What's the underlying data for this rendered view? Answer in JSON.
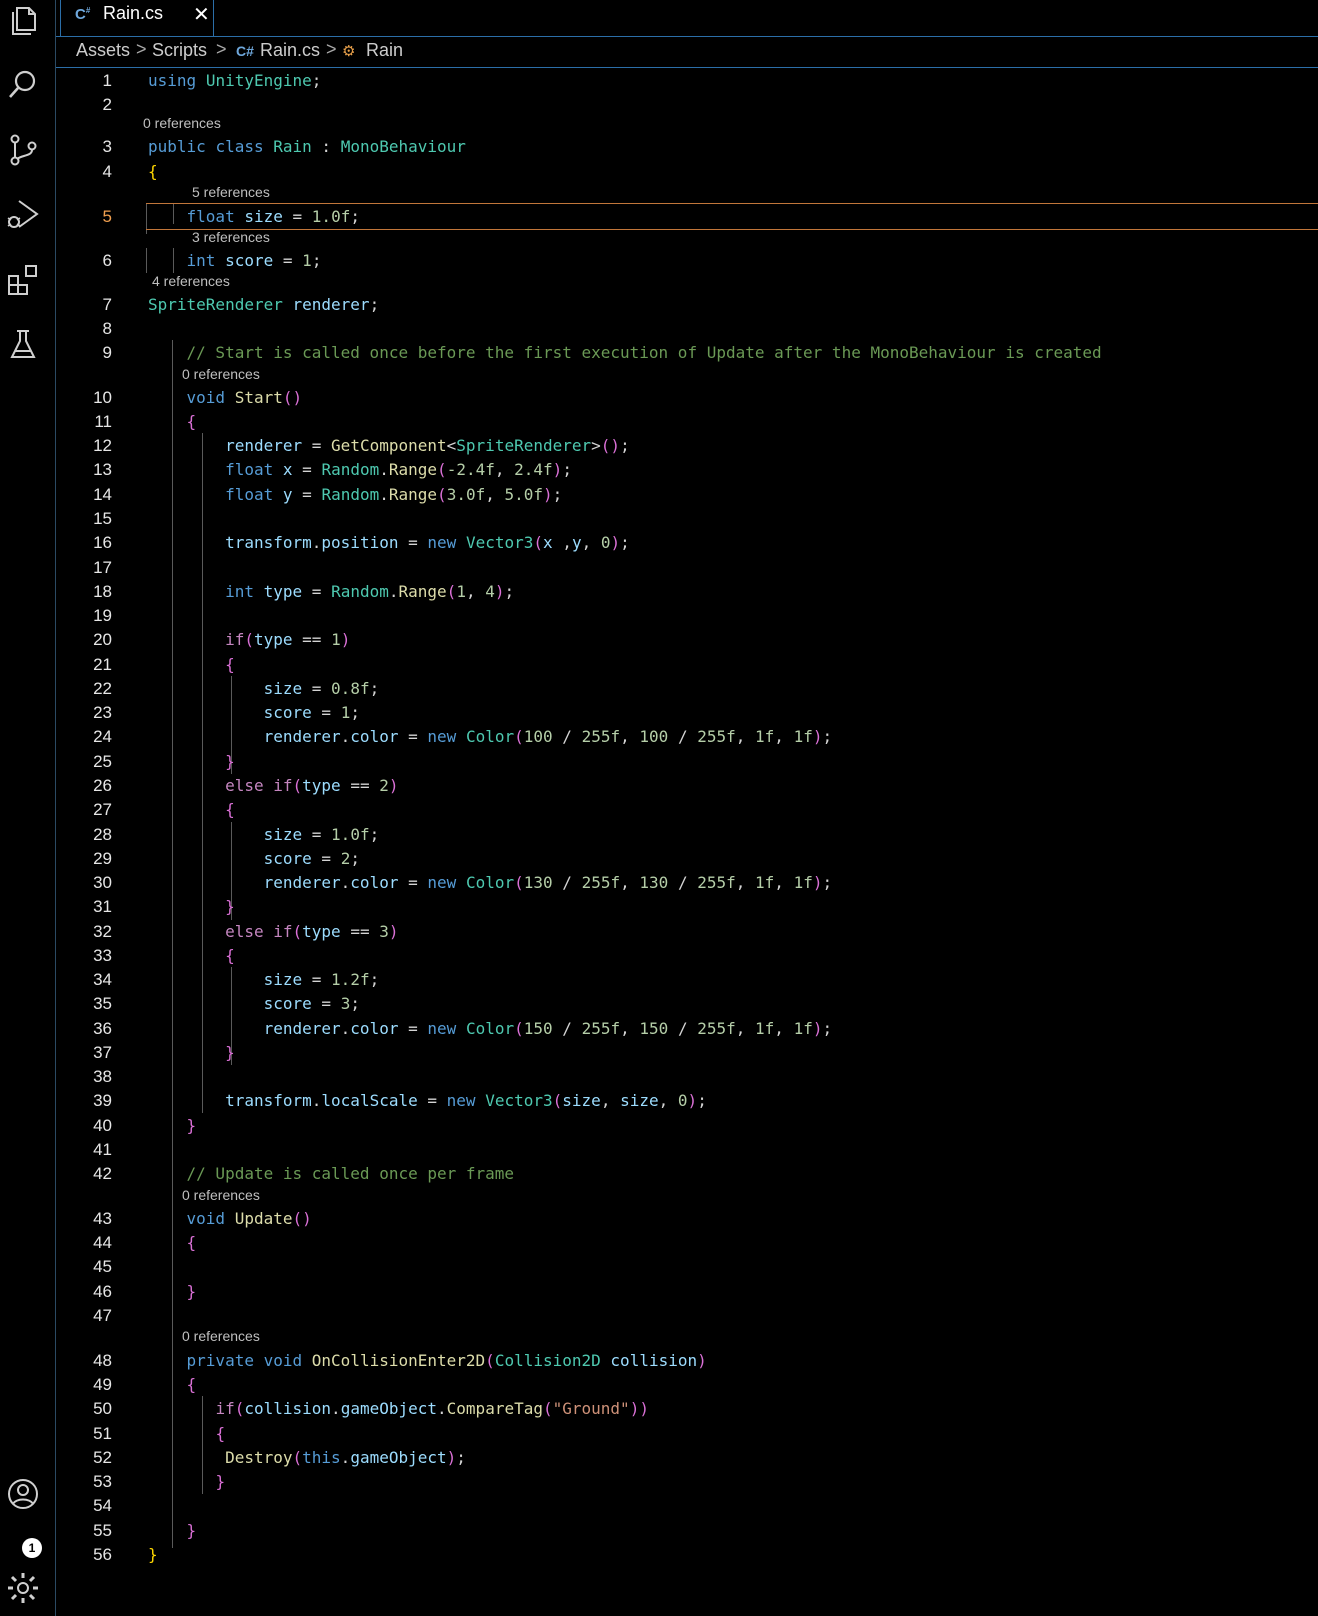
{
  "tab": {
    "label": "Rain.cs",
    "close": "✕",
    "cs_glyph": "C#"
  },
  "breadcrumb": {
    "items": [
      "Assets",
      "Scripts",
      "Rain.cs",
      "Rain"
    ],
    "separator": ">"
  },
  "activity_bar": {
    "icons": [
      "explorer-icon",
      "search-icon",
      "source-control-icon",
      "run-debug-icon",
      "extensions-icon",
      "testing-icon",
      "account-icon",
      "settings-gear-icon"
    ],
    "account_badge": "1"
  },
  "editor": {
    "current_line": 5,
    "code_lens": {
      "l3": "0 references",
      "l5": "5 references",
      "l6": "3 references",
      "l7": "4 references",
      "l10": "0 references",
      "l43": "0 references",
      "l48": "0 references"
    },
    "lines": [
      {
        "n": "1",
        "text": "using UnityEngine;"
      },
      {
        "n": "2",
        "text": ""
      },
      {
        "n": "3",
        "text": "public class Rain : MonoBehaviour"
      },
      {
        "n": "4",
        "text": "{"
      },
      {
        "n": "5",
        "text": "    float size = 1.0f;"
      },
      {
        "n": "6",
        "text": "    int score = 1;"
      },
      {
        "n": "7",
        "text": "SpriteRenderer renderer;"
      },
      {
        "n": "8",
        "text": ""
      },
      {
        "n": "9",
        "text": "    // Start is called once before the first execution of Update after the MonoBehaviour is created"
      },
      {
        "n": "10",
        "text": "    void Start()"
      },
      {
        "n": "11",
        "text": "    {"
      },
      {
        "n": "12",
        "text": "        renderer = GetComponent<SpriteRenderer>();"
      },
      {
        "n": "13",
        "text": "        float x = Random.Range(-2.4f, 2.4f);"
      },
      {
        "n": "14",
        "text": "        float y = Random.Range(3.0f, 5.0f);"
      },
      {
        "n": "15",
        "text": ""
      },
      {
        "n": "16",
        "text": "        transform.position = new Vector3(x ,y, 0);"
      },
      {
        "n": "17",
        "text": ""
      },
      {
        "n": "18",
        "text": "        int type = Random.Range(1, 4);"
      },
      {
        "n": "19",
        "text": ""
      },
      {
        "n": "20",
        "text": "        if(type == 1)"
      },
      {
        "n": "21",
        "text": "        {"
      },
      {
        "n": "22",
        "text": "            size = 0.8f;"
      },
      {
        "n": "23",
        "text": "            score = 1;"
      },
      {
        "n": "24",
        "text": "            renderer.color = new Color(100 / 255f, 100 / 255f, 1f, 1f);"
      },
      {
        "n": "25",
        "text": "        }"
      },
      {
        "n": "26",
        "text": "        else if(type == 2)"
      },
      {
        "n": "27",
        "text": "        {"
      },
      {
        "n": "28",
        "text": "            size = 1.0f;"
      },
      {
        "n": "29",
        "text": "            score = 2;"
      },
      {
        "n": "30",
        "text": "            renderer.color = new Color(130 / 255f, 130 / 255f, 1f, 1f);"
      },
      {
        "n": "31",
        "text": "        }"
      },
      {
        "n": "32",
        "text": "        else if(type == 3)"
      },
      {
        "n": "33",
        "text": "        {"
      },
      {
        "n": "34",
        "text": "            size = 1.2f;"
      },
      {
        "n": "35",
        "text": "            score = 3;"
      },
      {
        "n": "36",
        "text": "            renderer.color = new Color(150 / 255f, 150 / 255f, 1f, 1f);"
      },
      {
        "n": "37",
        "text": "        }"
      },
      {
        "n": "38",
        "text": ""
      },
      {
        "n": "39",
        "text": "        transform.localScale = new Vector3(size, size, 0);"
      },
      {
        "n": "40",
        "text": "    }"
      },
      {
        "n": "41",
        "text": ""
      },
      {
        "n": "42",
        "text": "    // Update is called once per frame"
      },
      {
        "n": "43",
        "text": "    void Update()"
      },
      {
        "n": "44",
        "text": "    {"
      },
      {
        "n": "45",
        "text": ""
      },
      {
        "n": "46",
        "text": "    }"
      },
      {
        "n": "47",
        "text": ""
      },
      {
        "n": "48",
        "text": "    private void OnCollisionEnter2D(Collision2D collision)"
      },
      {
        "n": "49",
        "text": "    {"
      },
      {
        "n": "50",
        "text": "       if(collision.gameObject.CompareTag(\"Ground\"))"
      },
      {
        "n": "51",
        "text": "       {"
      },
      {
        "n": "52",
        "text": "        Destroy(this.gameObject);"
      },
      {
        "n": "53",
        "text": "       }"
      },
      {
        "n": "54",
        "text": ""
      },
      {
        "n": "55",
        "text": "    }"
      },
      {
        "n": "56",
        "text": "}"
      }
    ]
  },
  "colors": {
    "background": "#000000",
    "keyword": "#569cd6",
    "control_keyword": "#c586c0",
    "type": "#4ec9b0",
    "identifier": "#9cdcfe",
    "function": "#dcdcaa",
    "number": "#b5cea8",
    "string": "#ce9178",
    "comment": "#6a9955",
    "current_line_border": "#c1763a",
    "accent_border": "#2b6ea8"
  }
}
